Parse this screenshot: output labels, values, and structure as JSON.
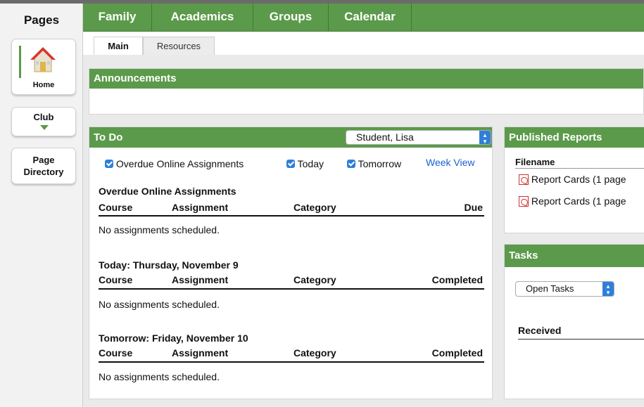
{
  "sidebar": {
    "title": "Pages",
    "items": [
      {
        "label": "Home",
        "icon": "house-icon"
      },
      {
        "label": "Club",
        "icon": "chevron-down-icon"
      },
      {
        "label_line1": "Page",
        "label_line2": "Directory"
      }
    ]
  },
  "nav": {
    "tabs": [
      {
        "label": "Family"
      },
      {
        "label": "Academics"
      },
      {
        "label": "Groups"
      },
      {
        "label": "Calendar"
      }
    ]
  },
  "subtabs": [
    {
      "label": "Main"
    },
    {
      "label": "Resources"
    }
  ],
  "announcements": {
    "title": "Announcements"
  },
  "todo": {
    "title": "To Do",
    "student_select": "Student, Lisa",
    "filters": {
      "overdue": "Overdue Online Assignments",
      "today": "Today",
      "tomorrow": "Tomorrow",
      "week_view": "Week View"
    },
    "sections": [
      {
        "heading": "Overdue Online Assignments",
        "columns": [
          "Course",
          "Assignment",
          "Category",
          "Due"
        ],
        "empty": "No assignments scheduled."
      },
      {
        "heading": "Today: Thursday, November 9",
        "columns": [
          "Course",
          "Assignment",
          "Category",
          "Completed"
        ],
        "empty": "No assignments scheduled."
      },
      {
        "heading": "Tomorrow: Friday, November 10",
        "columns": [
          "Course",
          "Assignment",
          "Category",
          "Completed"
        ],
        "empty": "No assignments scheduled."
      }
    ]
  },
  "reports": {
    "title": "Published Reports",
    "column": "Filename",
    "files": [
      "Report Cards (1 page",
      "Report Cards (1 page"
    ]
  },
  "tasks": {
    "title": "Tasks",
    "select": "Open Tasks",
    "column": "Received"
  },
  "colors": {
    "accent_green": "#5b9a4a",
    "link_blue": "#1a5fd0",
    "checkbox_blue": "#2f7fd9"
  }
}
